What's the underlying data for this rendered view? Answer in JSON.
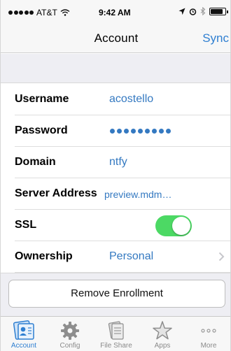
{
  "status_bar": {
    "carrier": "AT&T",
    "time": "9:42 AM"
  },
  "nav": {
    "title": "Account",
    "sync_label": "Sync"
  },
  "rows": [
    {
      "label": "Username",
      "value": "acostello"
    },
    {
      "label": "Password",
      "value": "•••••••••"
    },
    {
      "label": "Domain",
      "value": "ntfy"
    },
    {
      "label": "Server Address",
      "value": "preview.mdm…"
    },
    {
      "label": "SSL",
      "value": "on"
    },
    {
      "label": "Ownership",
      "value": "Personal"
    }
  ],
  "remove_label": "Remove Enrollment",
  "tabs": [
    {
      "label": "Account",
      "icon": "account-icon",
      "active": true
    },
    {
      "label": "Config",
      "icon": "gear-icon",
      "active": false
    },
    {
      "label": "File Share",
      "icon": "file-share-icon",
      "active": false
    },
    {
      "label": "Apps",
      "icon": "star-icon",
      "active": false
    },
    {
      "label": "More",
      "icon": "more-icon",
      "active": false
    }
  ],
  "colors": {
    "accent": "#2f7fd1",
    "value_text": "#3479c1",
    "toggle_on": "#4cd964"
  }
}
